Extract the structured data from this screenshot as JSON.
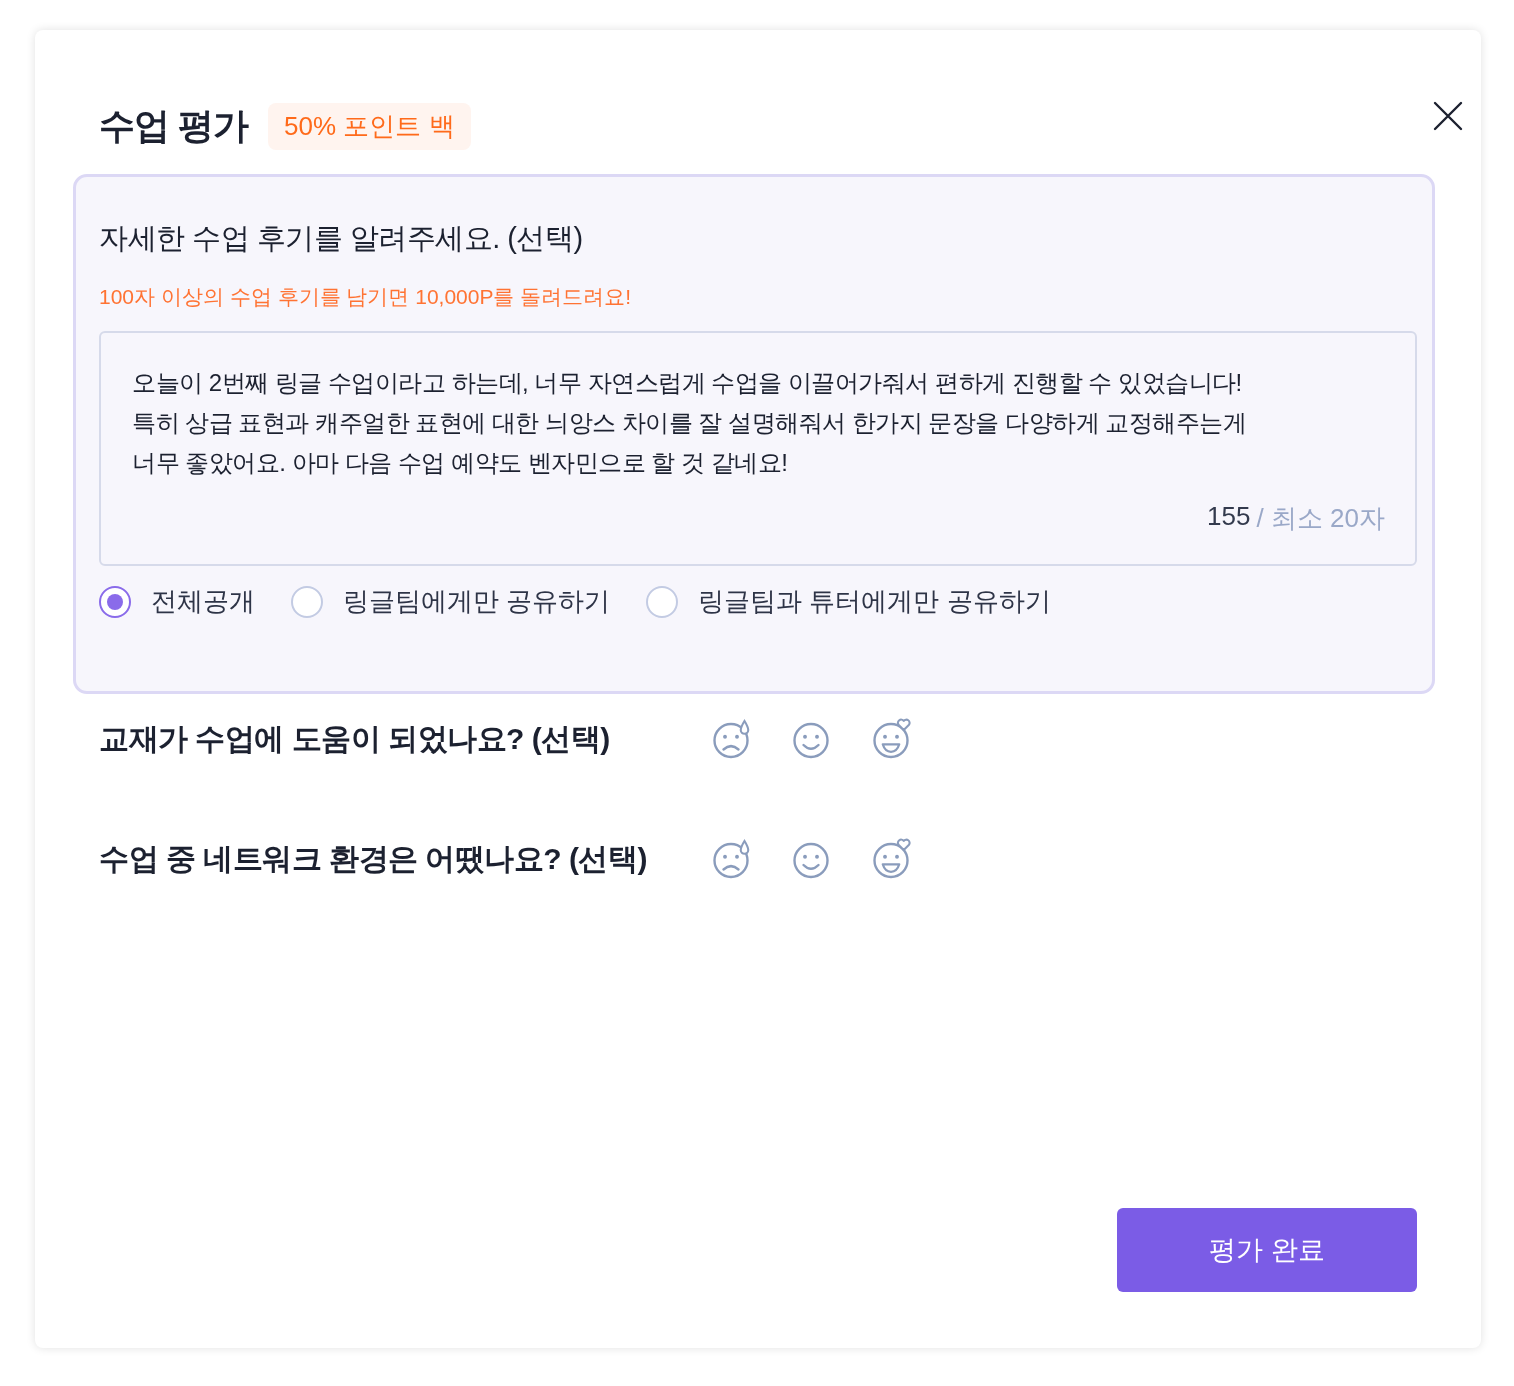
{
  "dialog": {
    "title": "수업 평가",
    "badge": "50% 포인트 백"
  },
  "review": {
    "question": "자세한 수업 후기를 알려주세요. (선택)",
    "hint": "100자 이상의 수업 후기를 남기면 10,000P를 돌려드려요!",
    "value": "오늘이 2번째 링글 수업이라고 하는데, 너무 자연스럽게 수업을 이끌어가줘서 편하게 진행할 수 있었습니다!\n특히 상급 표현과 캐주얼한 표현에 대한 늬앙스 차이를 잘 설명해줘서 한가지 문장을 다양하게 교정해주는게\n너무 좋았어요. 아마 다음 수업 예약도 벤자민으로 할 것 같네요!",
    "count": "155",
    "count_limit": "/ 최소 20자",
    "visibility": [
      {
        "label": "전체공개",
        "selected": true
      },
      {
        "label": "링글팀에게만 공유하기",
        "selected": false
      },
      {
        "label": "링글팀과 튜터에게만 공유하기",
        "selected": false
      }
    ]
  },
  "ratings": [
    {
      "question": "교재가 수업에 도움이 되었나요? (선택)",
      "faces": [
        {
          "kind": "sad"
        },
        {
          "kind": "smile"
        },
        {
          "kind": "love"
        }
      ]
    },
    {
      "question": "수업 중 네트워크 환경은 어땠나요? (선택)",
      "faces": [
        {
          "kind": "sad"
        },
        {
          "kind": "smile"
        },
        {
          "kind": "love"
        }
      ]
    }
  ],
  "submit_button": "평가 완료"
}
